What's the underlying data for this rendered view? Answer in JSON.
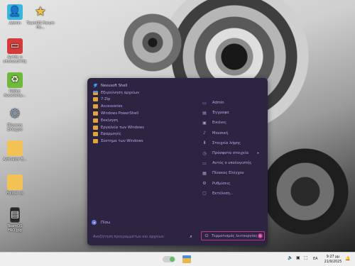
{
  "desktop": {
    "icons": [
      {
        "label": "Admin",
        "icon": "user-folder-icon",
        "color": "#3bb4e0"
      },
      {
        "label": "TeamOS Forum Ho...",
        "icon": "star-icon",
        "color": "#f0c040"
      },
      {
        "label": "Αυτός ο υπολογιστής",
        "icon": "computer-icon",
        "color": "#d43b3b"
      },
      {
        "label": "Κάδος Ανακύκλω...",
        "icon": "recycle-bin-icon",
        "color": "#6fba3a"
      },
      {
        "label": "Πίνακας Ελέγχου",
        "icon": "gear-icon",
        "color": "#8aa0b8"
      },
      {
        "label": "Activator E...",
        "icon": "folder-icon",
        "color": "#f3c255"
      },
      {
        "label": "Follow us",
        "icon": "folder-icon",
        "color": "#f3c255"
      },
      {
        "label": "TeamOS FAQ.jpg",
        "icon": "image-file-icon",
        "color": "#2a2a2a"
      }
    ]
  },
  "start_menu": {
    "programs": [
      {
        "label": "Nexusoft Shell",
        "icon": "nexus"
      },
      {
        "label": "Εξερεύνηση αρχείων",
        "icon": "folder-blue"
      },
      {
        "label": "7-Zip",
        "icon": "folder"
      },
      {
        "label": "Accessories",
        "icon": "folder"
      },
      {
        "label": "Windows PowerShell",
        "icon": "folder"
      },
      {
        "label": "Εκκίνηση",
        "icon": "folder"
      },
      {
        "label": "Εργαλεία των Windows",
        "icon": "folder"
      },
      {
        "label": "Εφαρμογές",
        "icon": "folder"
      },
      {
        "label": "Σύστημα των Windows",
        "icon": "folder"
      }
    ],
    "side_items": [
      {
        "label": "Admin",
        "glyph": "▭"
      },
      {
        "label": "Έγγραφα",
        "glyph": "▤"
      },
      {
        "label": "Εικόνες",
        "glyph": "▣"
      },
      {
        "label": "Μουσική",
        "glyph": "♪"
      },
      {
        "label": "Στοιχεία λήψης",
        "glyph": "⬇"
      },
      {
        "label": "Πρόσφατα στοιχεία",
        "glyph": "◷",
        "submenu": "▸"
      },
      {
        "label": "Αυτός ο υπολογιστής",
        "glyph": "▭"
      },
      {
        "label": "Πίνακας Ελέγχου",
        "glyph": "▦"
      },
      {
        "label": "Ρυθμίσεις",
        "glyph": "⚙"
      },
      {
        "label": "Εκτέλεση...",
        "glyph": "▢"
      }
    ],
    "back_label": "Πίσω",
    "search_placeholder": "Αναζήτηση προγραμμάτων και αρχείων",
    "shutdown_label": "Τερματισμός λειτουργίας"
  },
  "taskbar": {
    "language": "EA",
    "time": "9:27 μμ",
    "date": "21/9/2025"
  }
}
